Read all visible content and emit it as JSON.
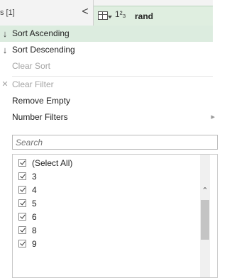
{
  "queries_pane": {
    "label": "s [1]",
    "collapse_glyph": "<"
  },
  "column_header": {
    "type_icon": "1²₃",
    "name": "rand"
  },
  "menu": {
    "sort_ascending": "Sort Ascending",
    "sort_descending": "Sort Descending",
    "clear_sort": "Clear Sort",
    "clear_filter": "Clear Filter",
    "remove_empty": "Remove Empty",
    "number_filters": "Number Filters"
  },
  "search": {
    "placeholder": "Search"
  },
  "values_list": {
    "items": [
      "(Select All)",
      "3",
      "4",
      "5",
      "6",
      "8",
      "9"
    ]
  },
  "colors": {
    "selected_row": "#dcecdf",
    "column_header_bg": "#dfeee0",
    "disabled_text": "#a3a3a3"
  }
}
